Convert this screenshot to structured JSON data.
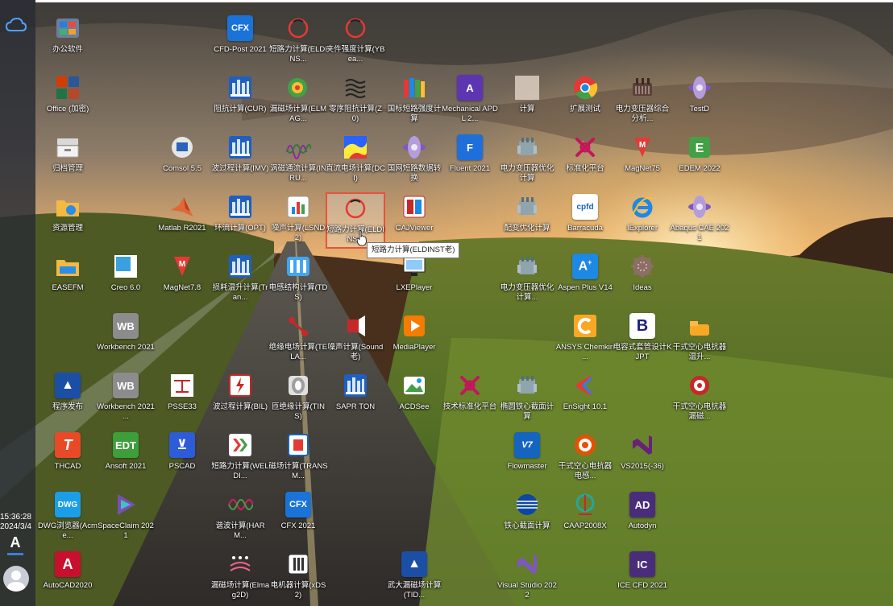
{
  "clock": {
    "time": "15:36:28",
    "date": "2024/3/4"
  },
  "font_glyph": "A",
  "icons": [
    {
      "id": "i1",
      "label": "办公软件",
      "kind": "folder"
    },
    {
      "id": "i2",
      "label": "Office (加密)",
      "kind": "office"
    },
    {
      "id": "i3",
      "label": "归档管理",
      "kind": "archive"
    },
    {
      "id": "i4",
      "label": "资源管理",
      "kind": "folder2"
    },
    {
      "id": "i5",
      "label": "EASEFM",
      "kind": "folder3"
    },
    {
      "id": "i6",
      "label": "程序发布",
      "kind": "ansys"
    },
    {
      "id": "i7",
      "label": "THCAD",
      "kind": "thcad"
    },
    {
      "id": "i8",
      "label": "DWG浏览器(Acme...",
      "kind": "dwg"
    },
    {
      "id": "i9",
      "label": "AutoCAD2020",
      "kind": "autocad"
    },
    {
      "id": "i10",
      "label": "Comsol 5.5",
      "kind": "comsol"
    },
    {
      "id": "i11",
      "label": "Matlab R2021",
      "kind": "matlab"
    },
    {
      "id": "i12",
      "label": "Creo 6.0",
      "kind": "creo"
    },
    {
      "id": "i13",
      "label": "Workbench 2021",
      "kind": "wb"
    },
    {
      "id": "i14",
      "label": "Workbench 2021 ...",
      "kind": "wb"
    },
    {
      "id": "i15",
      "label": "Ansoft 2021",
      "kind": "edt"
    },
    {
      "id": "i16",
      "label": "SpaceClaim 2021",
      "kind": "spaceclaim"
    },
    {
      "id": "i17",
      "label": "MagNet7.8",
      "kind": "magnet"
    },
    {
      "id": "i18",
      "label": "PSSE33",
      "kind": "psse"
    },
    {
      "id": "i19",
      "label": "PSCAD",
      "kind": "pscad"
    },
    {
      "id": "i20",
      "label": "CFD-Post 2021",
      "kind": "cfx"
    },
    {
      "id": "i21",
      "label": "阻抗计算(CUR)",
      "kind": "tower"
    },
    {
      "id": "i22",
      "label": "波过程计算(IMV)",
      "kind": "tower"
    },
    {
      "id": "i23",
      "label": "环流计算(OPT)",
      "kind": "tower"
    },
    {
      "id": "i24",
      "label": "损耗温升计算(Tran...",
      "kind": "tower"
    },
    {
      "id": "i25",
      "label": "波过程计算(BIL)",
      "kind": "bil"
    },
    {
      "id": "i26",
      "label": "短路力计算(WELDI...",
      "kind": "weldi"
    },
    {
      "id": "i27",
      "label": "谐波计算(HARM...",
      "kind": "harm"
    },
    {
      "id": "i28",
      "label": "漏磁场计算(Elmag2D)",
      "kind": "elmag2d"
    },
    {
      "id": "i29",
      "label": "短路力计算(ELDINS...",
      "kind": "eldins"
    },
    {
      "id": "i30",
      "label": "漏磁场计算(ELMAG...",
      "kind": "elmag"
    },
    {
      "id": "i31",
      "label": "涡磁通流计算(INRU...",
      "kind": "inru"
    },
    {
      "id": "i32",
      "label": "噪声计算(LSND2)",
      "kind": "chart"
    },
    {
      "id": "i33",
      "label": "电感结构计算(TDS)",
      "kind": "tds"
    },
    {
      "id": "i34",
      "label": "绝缘电场计算(TELA...",
      "kind": "tela"
    },
    {
      "id": "i35",
      "label": "匝绝缘计算(TINS)",
      "kind": "tins"
    },
    {
      "id": "i36",
      "label": "磁场计算(TRANSM...",
      "kind": "transm"
    },
    {
      "id": "i37",
      "label": "CFX 2021",
      "kind": "cfx"
    },
    {
      "id": "i38",
      "label": "电机器计算(xDS2)",
      "kind": "xds2"
    },
    {
      "id": "i39",
      "label": "夹件强度计算(YBea...",
      "kind": "eldins"
    },
    {
      "id": "i40",
      "label": "零序阻抗计算(Z0)",
      "kind": "z0"
    },
    {
      "id": "i41",
      "label": "直流电场计算(DCI)",
      "kind": "dci"
    },
    {
      "id": "i42",
      "label": "短路力计算(ELDINS...",
      "kind": "eldins"
    },
    {
      "id": "i43",
      "label": "噪声计算(Sound老)",
      "kind": "sound"
    },
    {
      "id": "i44",
      "label": "SAPR TON",
      "kind": "tower"
    },
    {
      "id": "i45",
      "label": "国标短路强度计算",
      "kind": "books"
    },
    {
      "id": "i46",
      "label": "国网短路数据转换",
      "kind": "disc"
    },
    {
      "id": "i47",
      "label": "CAJViewer",
      "kind": "caj"
    },
    {
      "id": "i48",
      "label": "LXEPlayer",
      "kind": "lxe"
    },
    {
      "id": "i49",
      "label": "MediaPlayer",
      "kind": "media"
    },
    {
      "id": "i50",
      "label": "ACDSee",
      "kind": "acdsee"
    },
    {
      "id": "i51",
      "label": "武大漏磁场计算(TID...",
      "kind": "ansys"
    },
    {
      "id": "i52",
      "label": "Mechanical APDL 2...",
      "kind": "apdl"
    },
    {
      "id": "i53",
      "label": "Fluent 2021",
      "kind": "fluent"
    },
    {
      "id": "i54",
      "label": "技术标准化平台",
      "kind": "knot"
    },
    {
      "id": "i55",
      "label": "计算",
      "kind": "blank"
    },
    {
      "id": "i56",
      "label": "电力变压器优化计算",
      "kind": "transformer"
    },
    {
      "id": "i57",
      "label": "配变优化计算",
      "kind": "transformer"
    },
    {
      "id": "i58",
      "label": "电力变压器优化计算...",
      "kind": "transformer"
    },
    {
      "id": "i59",
      "label": "椭圆铁心截面计算",
      "kind": "transformer"
    },
    {
      "id": "i60",
      "label": "Flowmaster",
      "kind": "flowmaster"
    },
    {
      "id": "i61",
      "label": "铁心截面计算",
      "kind": "globe"
    },
    {
      "id": "i62",
      "label": "Visual Studio 2022",
      "kind": "vs"
    },
    {
      "id": "i63",
      "label": "扩展测试",
      "kind": "chrome"
    },
    {
      "id": "i64",
      "label": "标准化平台",
      "kind": "knot"
    },
    {
      "id": "i65",
      "label": "Barracuda",
      "kind": "cpfd"
    },
    {
      "id": "i66",
      "label": "Aspen Plus V14",
      "kind": "aspen"
    },
    {
      "id": "i67",
      "label": "ANSYS Chemkin ...",
      "kind": "chemkin"
    },
    {
      "id": "i68",
      "label": "EnSight 10.1",
      "kind": "ensight"
    },
    {
      "id": "i69",
      "label": "干式空心电抗器电感...",
      "kind": "coil"
    },
    {
      "id": "i70",
      "label": "CAAP2008X",
      "kind": "caap"
    },
    {
      "id": "i71",
      "label": "电力变压器综合分析...",
      "kind": "transformer2"
    },
    {
      "id": "i72",
      "label": "MagNet75",
      "kind": "magnet"
    },
    {
      "id": "i73",
      "label": "IExplorer",
      "kind": "ie"
    },
    {
      "id": "i74",
      "label": "Ideas",
      "kind": "ideas"
    },
    {
      "id": "i75",
      "label": "电容式套管设计KJPT",
      "kind": "kjpt"
    },
    {
      "id": "i76",
      "label": "VS2015(-36)",
      "kind": "vs2015"
    },
    {
      "id": "i77",
      "label": "Autodyn",
      "kind": "ad"
    },
    {
      "id": "i78",
      "label": "ICE CFD 2021",
      "kind": "ic"
    },
    {
      "id": "i79",
      "label": "TestD",
      "kind": "disc"
    },
    {
      "id": "i80",
      "label": "EDEM 2022",
      "kind": "edem"
    },
    {
      "id": "i81",
      "label": "Abaqus CAE 2021",
      "kind": "disc"
    },
    {
      "id": "i82",
      "label": "干式空心电抗器温升...",
      "kind": "coil2"
    },
    {
      "id": "i83",
      "label": "干式空心电抗器漏磁...",
      "kind": "coil3"
    }
  ],
  "tooltip": "短路力计算(ELDINST老)",
  "colors": {
    "selection_border": "#e5533d",
    "taskbar": "#282c34",
    "text": "#ffffff"
  }
}
